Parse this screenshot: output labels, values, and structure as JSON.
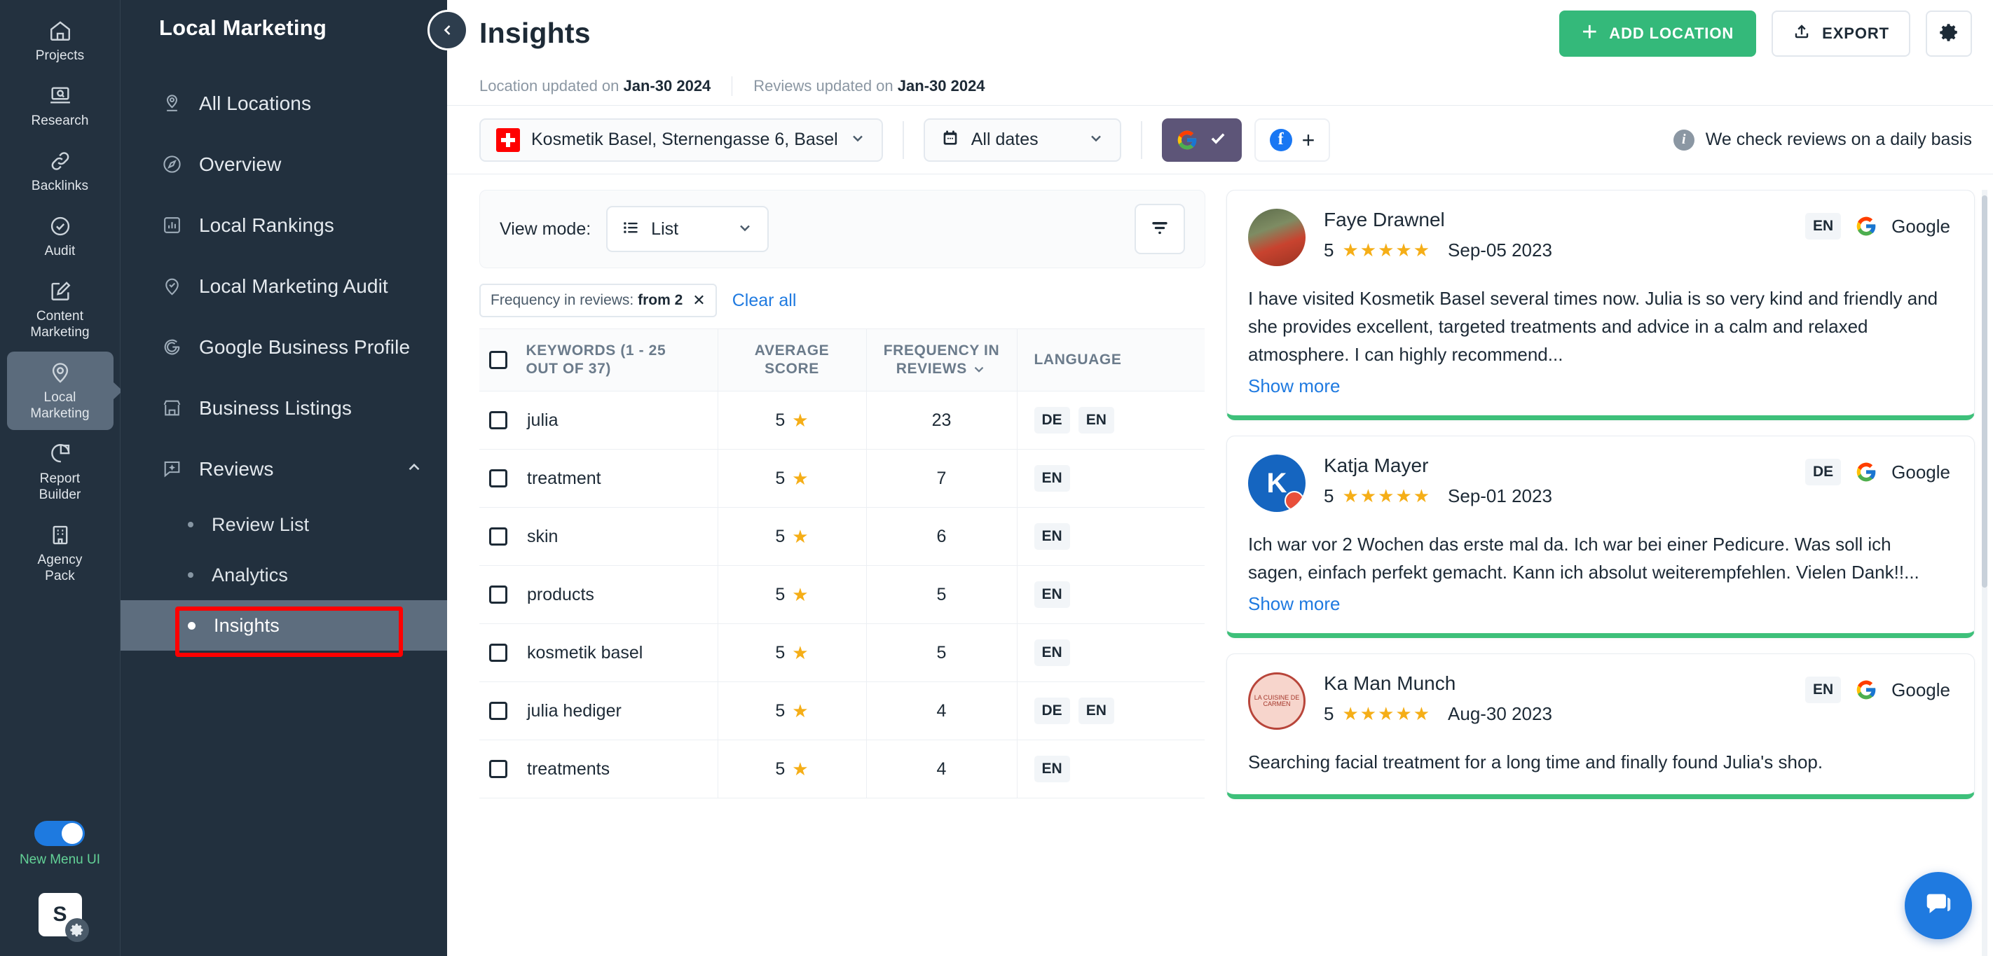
{
  "rail": {
    "items": [
      {
        "label": "Projects",
        "icon": "home-icon",
        "active": false
      },
      {
        "label": "Research",
        "icon": "research-icon",
        "active": false
      },
      {
        "label": "Backlinks",
        "icon": "link-icon",
        "active": false
      },
      {
        "label": "Audit",
        "icon": "check-circle-icon",
        "active": false
      },
      {
        "label": "Content\nMarketing",
        "icon": "edit-icon",
        "active": false
      },
      {
        "label": "Local\nMarketing",
        "icon": "map-pin-icon",
        "active": true
      },
      {
        "label": "Report\nBuilder",
        "icon": "pie-chart-icon",
        "active": false
      },
      {
        "label": "Agency\nPack",
        "icon": "building-icon",
        "active": false
      }
    ],
    "toggle_label": "New Menu UI",
    "toggle_on": true,
    "avatar_letter": "S"
  },
  "subnav": {
    "title": "Local Marketing",
    "items": [
      {
        "label": "All Locations",
        "icon": "location-pin-icon"
      },
      {
        "label": "Overview",
        "icon": "compass-icon"
      },
      {
        "label": "Local Rankings",
        "icon": "bar-chart-icon"
      },
      {
        "label": "Local Marketing Audit",
        "icon": "pin-check-icon"
      },
      {
        "label": "Google Business Profile",
        "icon": "google-g-icon"
      },
      {
        "label": "Business Listings",
        "icon": "storefront-icon"
      },
      {
        "label": "Reviews",
        "icon": "review-bubble-icon",
        "expanded": true
      }
    ],
    "children": [
      {
        "label": "Review List",
        "selected": false
      },
      {
        "label": "Analytics",
        "selected": false
      },
      {
        "label": "Insights",
        "selected": true
      }
    ]
  },
  "header": {
    "title": "Insights",
    "add_location_label": "ADD LOCATION",
    "export_label": "EXPORT",
    "settings_icon": "gear-icon"
  },
  "meta": {
    "location_updated_prefix": "Location updated on",
    "location_updated_date": "Jan-30 2024",
    "reviews_updated_prefix": "Reviews updated on",
    "reviews_updated_date": "Jan-30 2024"
  },
  "filters": {
    "location": "Kosmetik Basel, Sternengasse 6, Basel",
    "date_range": "All dates",
    "source_google_selected": true,
    "source_facebook_label": "+",
    "notice": "We check reviews on a daily basis"
  },
  "table_panel": {
    "view_mode_label": "View mode:",
    "view_mode_value": "List",
    "filter_icon": "filter-icon",
    "chip_label": "Frequency in reviews:",
    "chip_value": "from 2",
    "clear_all": "Clear all"
  },
  "chart_data": {
    "type": "table",
    "title": "Keyword insights",
    "columns": [
      "KEYWORDS (1 - 25 OUT OF 37)",
      "AVERAGE SCORE",
      "FREQUENCY IN REVIEWS",
      "LANGUAGE"
    ],
    "rows": [
      {
        "keyword": "julia",
        "average_score": 5,
        "frequency": 23,
        "languages": [
          "DE",
          "EN"
        ]
      },
      {
        "keyword": "treatment",
        "average_score": 5,
        "frequency": 7,
        "languages": [
          "EN"
        ]
      },
      {
        "keyword": "skin",
        "average_score": 5,
        "frequency": 6,
        "languages": [
          "EN"
        ]
      },
      {
        "keyword": "products",
        "average_score": 5,
        "frequency": 5,
        "languages": [
          "EN"
        ]
      },
      {
        "keyword": "kosmetik basel",
        "average_score": 5,
        "frequency": 5,
        "languages": [
          "EN"
        ]
      },
      {
        "keyword": "julia hediger",
        "average_score": 5,
        "frequency": 4,
        "languages": [
          "DE",
          "EN"
        ]
      },
      {
        "keyword": "treatments",
        "average_score": 5,
        "frequency": 4,
        "languages": [
          "EN"
        ]
      }
    ]
  },
  "reviews": [
    {
      "author": "Faye Drawnel",
      "rating": 5,
      "stars": "★★★★★",
      "date": "Sep-05 2023",
      "language": "EN",
      "source": "Google",
      "text": "I have visited Kosmetik Basel several times now. Julia is so very kind and friendly and she provides excellent, targeted treatments and advice in a calm and relaxed atmosphere. I can highly recommend...",
      "show_more": "Show more",
      "avatar_style": "img1"
    },
    {
      "author": "Katja Mayer",
      "rating": 5,
      "stars": "★★★★★",
      "date": "Sep-01 2023",
      "language": "DE",
      "source": "Google",
      "text": "Ich war vor 2 Wochen das erste mal da. Ich war bei einer Pedicure. Was soll ich sagen, einfach perfekt gemacht. Kann ich absolut weiterempfehlen. Vielen Dank!!...",
      "show_more": "Show more",
      "avatar_style": "img2",
      "avatar_letter": "K"
    },
    {
      "author": "Ka Man Munch",
      "rating": 5,
      "stars": "★★★★★",
      "date": "Aug-30 2023",
      "language": "EN",
      "source": "Google",
      "text": "Searching facial treatment for a long time and finally found Julia's shop.",
      "show_more": "",
      "avatar_style": "img3",
      "avatar_text": "LA CUISINE DE CARMEN"
    }
  ],
  "colors": {
    "accent_green": "#34b97a",
    "link_blue": "#1f7ae0",
    "star_yellow": "#f5ae17",
    "sidebar_dark": "#22303e",
    "highlight_red": "#ff0000",
    "google_purple": "#5d5578"
  }
}
